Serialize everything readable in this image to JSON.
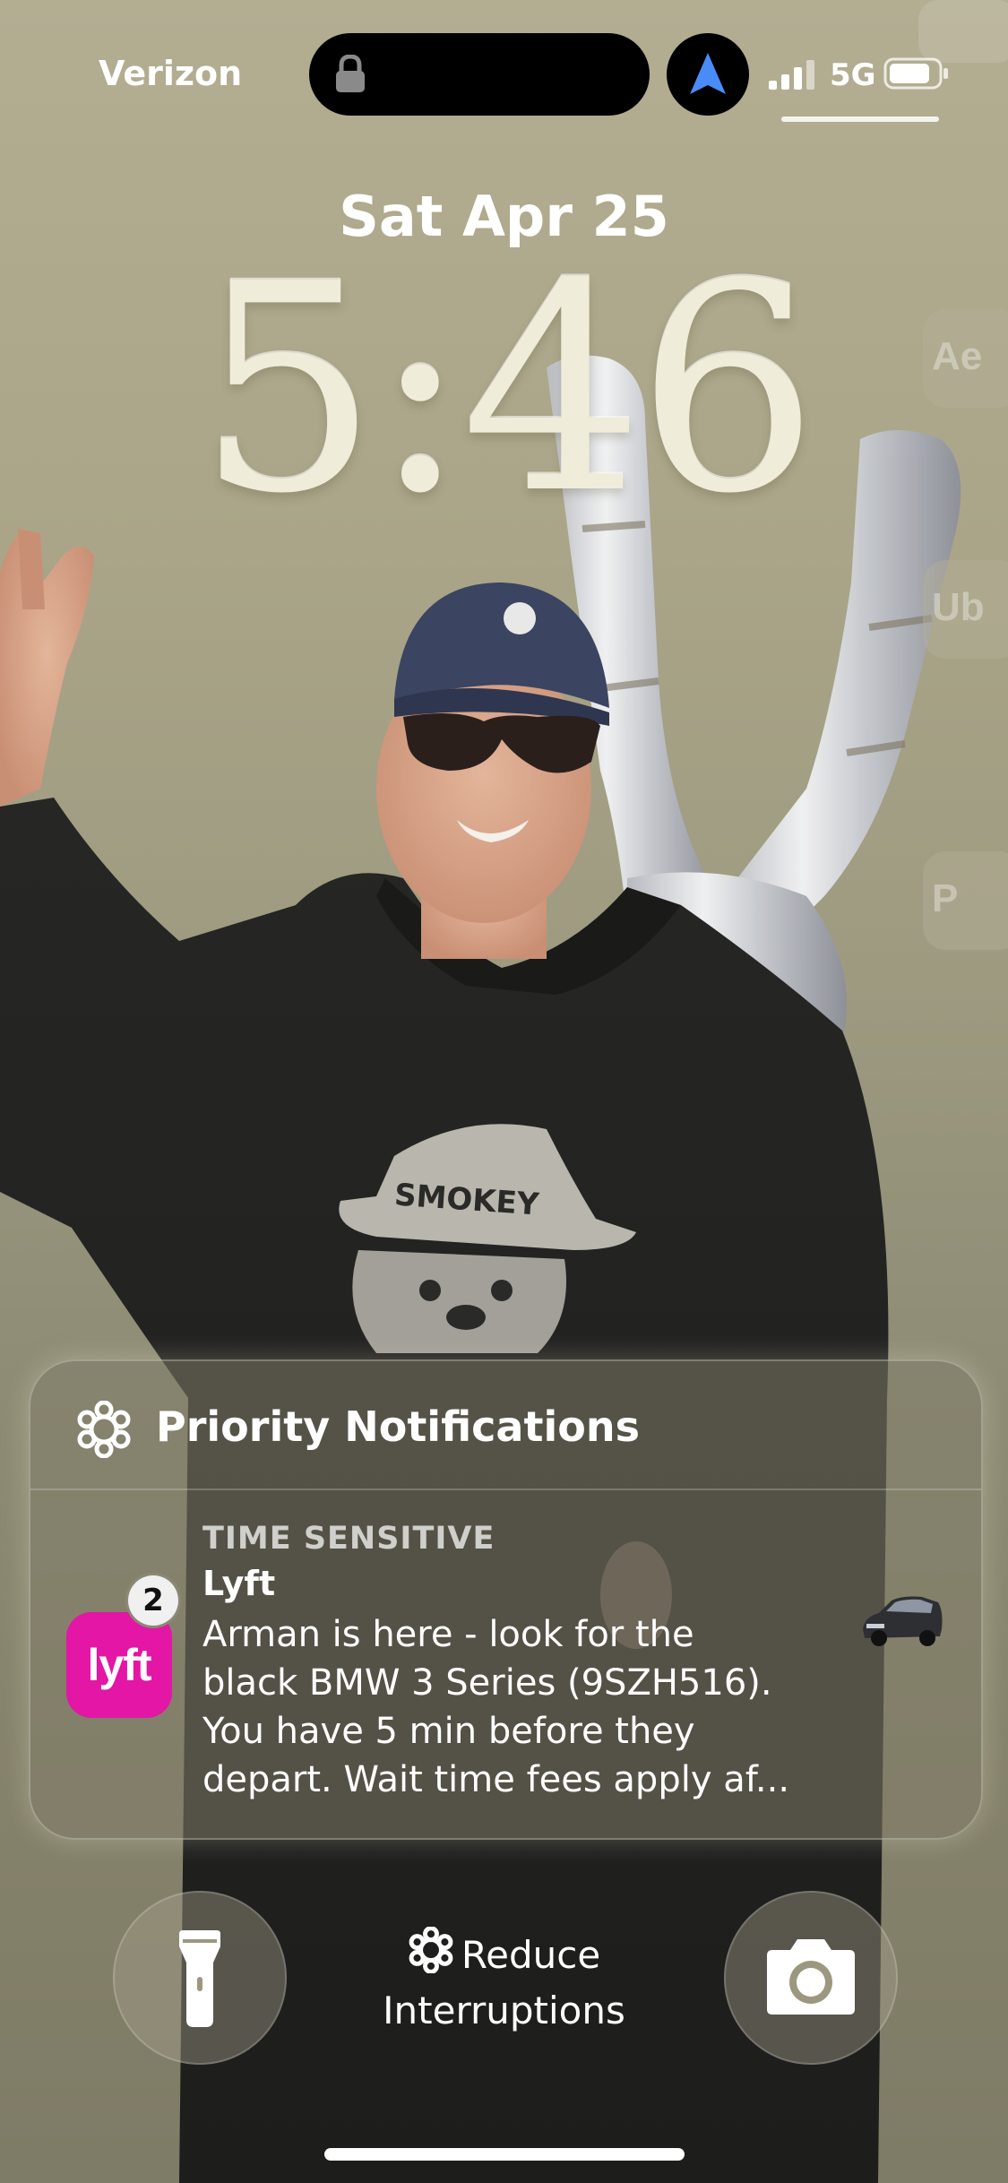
{
  "status_bar": {
    "carrier": "Verizon",
    "network": "5G",
    "battery_icon": "battery-icon",
    "signal_icon": "signal-bars-icon",
    "navigation_icon": "location-arrow-icon"
  },
  "lock_screen": {
    "date": "Sat Apr 25",
    "time": "5:46"
  },
  "notification_stack": {
    "header_icon": "focus-gear-icon",
    "header_title": "Priority Notifications",
    "notification": {
      "kicker": "TIME SENSITIVE",
      "app_name": "Lyft",
      "app_icon_text": "lyft",
      "app_icon_color": "#e316a6",
      "badge_count": "2",
      "body_lines": [
        "Arman is here - look for the",
        "black BMW 3 Series (9SZH516).",
        "You have 5 min before they",
        "depart. Wait time fees apply af..."
      ],
      "thumbnail_icon": "car-thumbnail"
    }
  },
  "bottom_controls": {
    "flashlight_icon": "flashlight-icon",
    "focus_label_line1": "Reduce",
    "focus_label_line2": "Interruptions",
    "camera_icon": "camera-icon"
  },
  "wallpaper": {
    "shirt_text": "SMOKEY"
  }
}
